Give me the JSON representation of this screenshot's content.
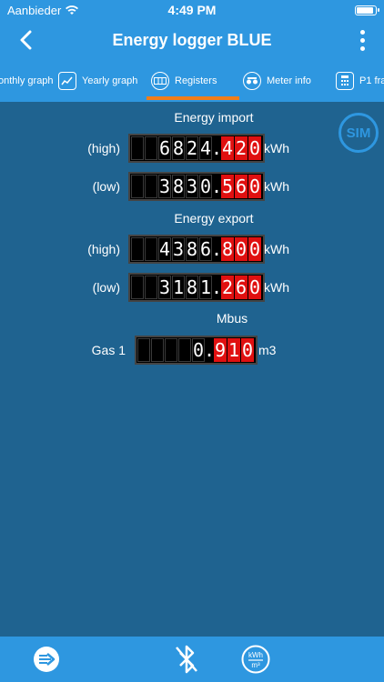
{
  "status": {
    "carrier": "Aanbieder",
    "time": "4:49 PM"
  },
  "nav": {
    "title": "Energy logger BLUE"
  },
  "tabs": [
    {
      "label": "onthly graph"
    },
    {
      "label": "Yearly graph"
    },
    {
      "label": "Registers",
      "active": true
    },
    {
      "label": "Meter info"
    },
    {
      "label": "P1 fra"
    }
  ],
  "badge": "SIM",
  "import": {
    "title": "Energy import",
    "high": {
      "label": "(high)",
      "int": [
        "",
        "",
        "6",
        "8",
        "2",
        "4"
      ],
      "dec": [
        "4",
        "2",
        "0"
      ],
      "unit": "kWh"
    },
    "low": {
      "label": "(low)",
      "int": [
        "",
        "",
        "3",
        "8",
        "3",
        "0"
      ],
      "dec": [
        "5",
        "6",
        "0"
      ],
      "unit": "kWh"
    }
  },
  "export": {
    "title": "Energy export",
    "high": {
      "label": "(high)",
      "int": [
        "",
        "",
        "4",
        "3",
        "8",
        "6"
      ],
      "dec": [
        "8",
        "0",
        "0"
      ],
      "unit": "kWh"
    },
    "low": {
      "label": "(low)",
      "int": [
        "",
        "",
        "3",
        "1",
        "8",
        "1"
      ],
      "dec": [
        "2",
        "6",
        "0"
      ],
      "unit": "kWh"
    }
  },
  "mbus": {
    "title": "Mbus",
    "gas1": {
      "label": "Gas 1",
      "int": [
        "",
        "",
        "",
        "",
        "0"
      ],
      "dec": [
        "9",
        "1",
        "0"
      ],
      "unit": "m3"
    }
  },
  "colors": {
    "header": "#2e97e0",
    "background": "#1f6390",
    "accent": "#f07d1a",
    "decimal": "#e01010"
  }
}
